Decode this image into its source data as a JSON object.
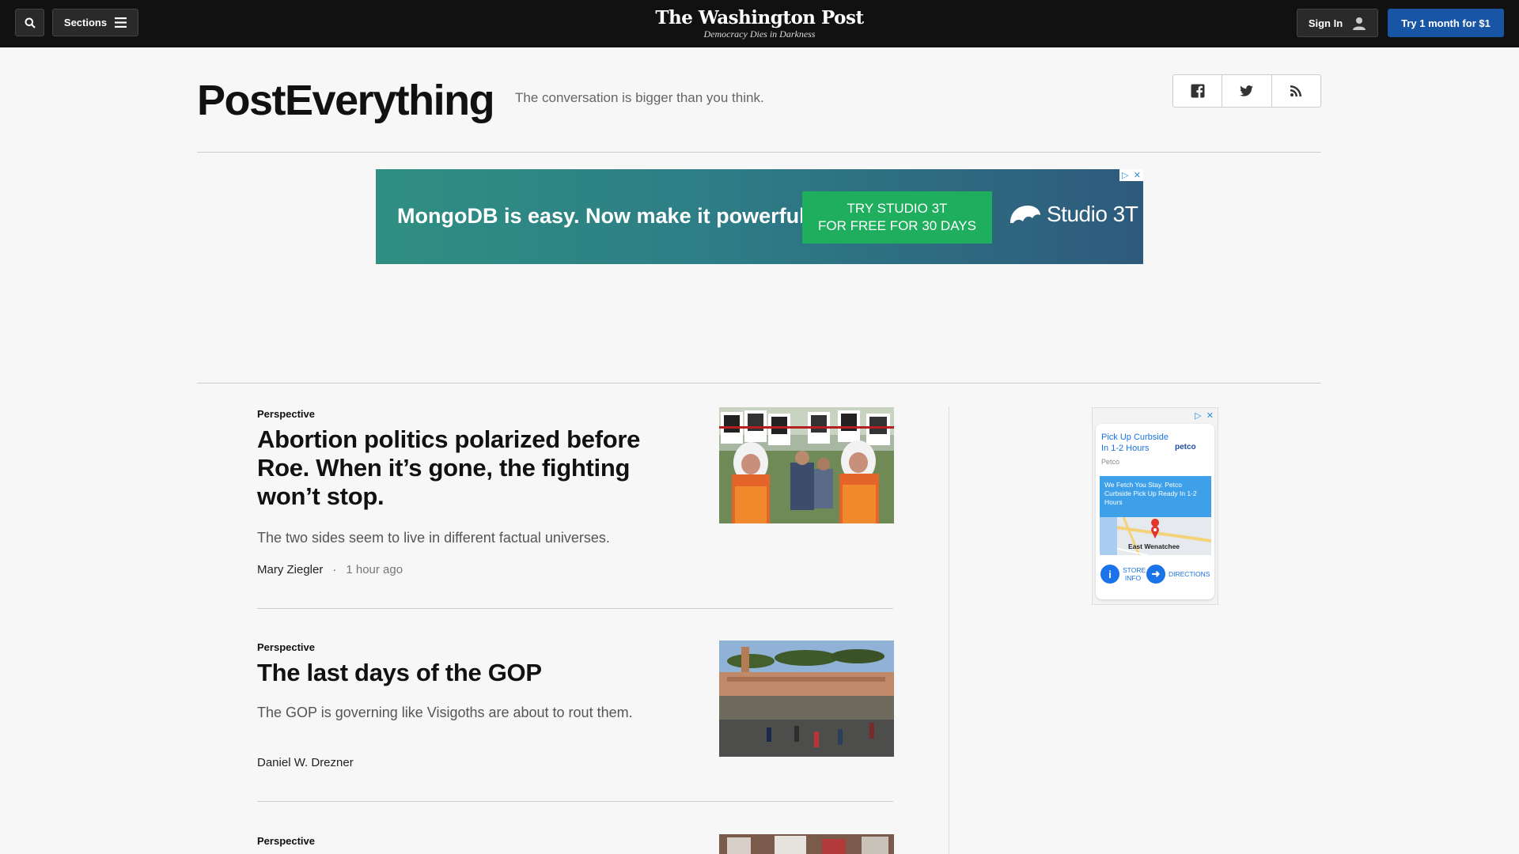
{
  "nav": {
    "sections_label": "Sections",
    "masthead_name": "The Washington Post",
    "masthead_tagline": "Democracy Dies in Darkness",
    "signin_label": "Sign In",
    "try_label": "Try 1 month for $1"
  },
  "header": {
    "title": "PostEverything",
    "tagline": "The conversation is bigger than you think.",
    "share_icons": [
      "facebook-icon",
      "twitter-icon",
      "rss-icon"
    ]
  },
  "top_ad": {
    "headline": "MongoDB is easy. Now make it powerful.",
    "cta_line1": "TRY STUDIO 3T",
    "cta_line2": "FOR FREE FOR 30 DAYS",
    "logo": "Studio 3T"
  },
  "articles": [
    {
      "kicker": "Perspective",
      "headline": "Abortion politics polarized before Roe. When it’s gone, the fighting won’t stop.",
      "dek": "The two sides seem to live in different factual universes.",
      "author": "Mary Ziegler",
      "separator": "·",
      "time": "1 hour ago"
    },
    {
      "kicker": "Perspective",
      "headline": "The last days of the GOP",
      "dek": "The GOP is governing like Visigoths are about to rout them.",
      "author": "Daniel W. Drezner"
    },
    {
      "kicker": "Perspective"
    }
  ],
  "side_ad": {
    "title": "Pick Up Curbside In 1-2 Hours",
    "brand": "petco",
    "advertiser": "Petco",
    "blurb": "We Fetch You Stay. Petco Curbside Pick Up Ready In 1-2 Hours",
    "city": "East Wenatchee",
    "store_info": "STORE INFO",
    "directions": "DIRECTIONS"
  },
  "colors": {
    "nav_bg": "#111111",
    "try_button": "#1955a5",
    "ad_cta": "#1fad5e"
  }
}
